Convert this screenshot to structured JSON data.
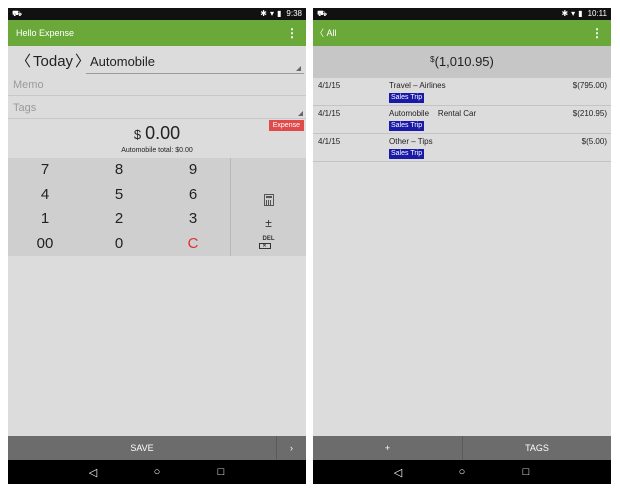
{
  "left": {
    "status": {
      "notif": "⛟",
      "time": "9:38"
    },
    "appbar": {
      "title": "Hello Expense",
      "menu": "⋮"
    },
    "date_nav": {
      "prev": "〈",
      "label": "Today",
      "next": "〉"
    },
    "category": "Automobile",
    "memo_placeholder": "Memo",
    "tags_placeholder": "Tags",
    "expense_badge": "Expense",
    "amount": {
      "currency": "$",
      "value": "0.00"
    },
    "automobile_total": "Automobile total: $0.00",
    "keypad": [
      "7",
      "8",
      "9",
      "4",
      "5",
      "6",
      "1",
      "2",
      "3",
      "00",
      "0",
      "C"
    ],
    "side_keys": {
      "plusminus": "±",
      "del": "DEL"
    },
    "save_label": "SAVE",
    "next_label": "›"
  },
  "right": {
    "status": {
      "notif": "⛟",
      "time": "10:11"
    },
    "appbar": {
      "back": "〈 All",
      "menu": "⋮"
    },
    "total": {
      "currency": "$",
      "value": "(1,010.95)"
    },
    "rows": [
      {
        "date": "4/1/15",
        "desc": "Travel – Airlines",
        "amount": "$(795.00)",
        "tag": "Sales Trip"
      },
      {
        "date": "4/1/15",
        "desc": "Automobile    Rental Car",
        "amount": "$(210.95)",
        "tag": "Sales Trip"
      },
      {
        "date": "4/1/15",
        "desc": "Other – Tips",
        "amount": "$(5.00)",
        "tag": "Sales Trip"
      }
    ],
    "add_label": "+",
    "tags_label": "TAGS"
  },
  "nav": {
    "back": "◁",
    "home": "○",
    "recent": "□"
  },
  "colors": {
    "appbar": "#6aa83a",
    "expense_badge": "#e04a4a",
    "tag_bg": "#1a1aa8",
    "clear_key": "#e03030"
  },
  "icons": {
    "status_bluetooth": "bluetooth-icon",
    "status_wifi": "wifi-icon",
    "status_battery": "battery-icon",
    "calculator": "calculator-icon"
  }
}
